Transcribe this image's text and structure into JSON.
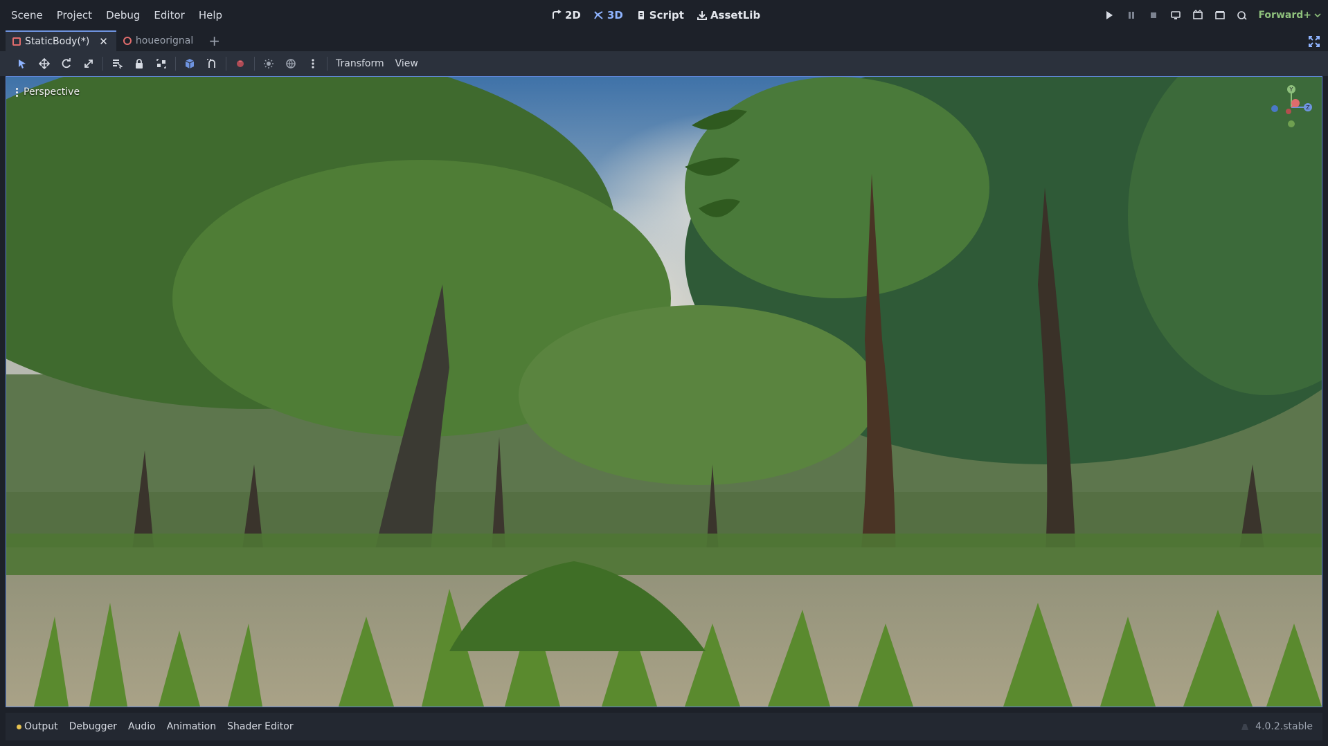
{
  "menu": [
    "Scene",
    "Project",
    "Debug",
    "Editor",
    "Help"
  ],
  "workspaces": [
    {
      "label": "2D",
      "icon": "2d-icon",
      "active": false
    },
    {
      "label": "3D",
      "icon": "3d-icon",
      "active": true
    },
    {
      "label": "Script",
      "icon": "script-icon",
      "active": false
    },
    {
      "label": "AssetLib",
      "icon": "assetlib-icon",
      "active": false
    }
  ],
  "renderer": "Forward+",
  "scene_tabs": [
    {
      "label": "StaticBody(*)",
      "active": true
    },
    {
      "label": "houeorignal",
      "active": false
    }
  ],
  "toolbar": {
    "transform_menu": "Transform",
    "view_menu": "View"
  },
  "viewport": {
    "label": "Perspective"
  },
  "gizmo_axes": [
    "Y",
    "Z"
  ],
  "bottom_tabs": [
    "Output",
    "Debugger",
    "Audio",
    "Animation",
    "Shader Editor"
  ],
  "version": "4.0.2.stable",
  "colors": {
    "accent": "#6f94e0",
    "renderer": "#8ec07c",
    "output_dot": "#e8c350"
  }
}
